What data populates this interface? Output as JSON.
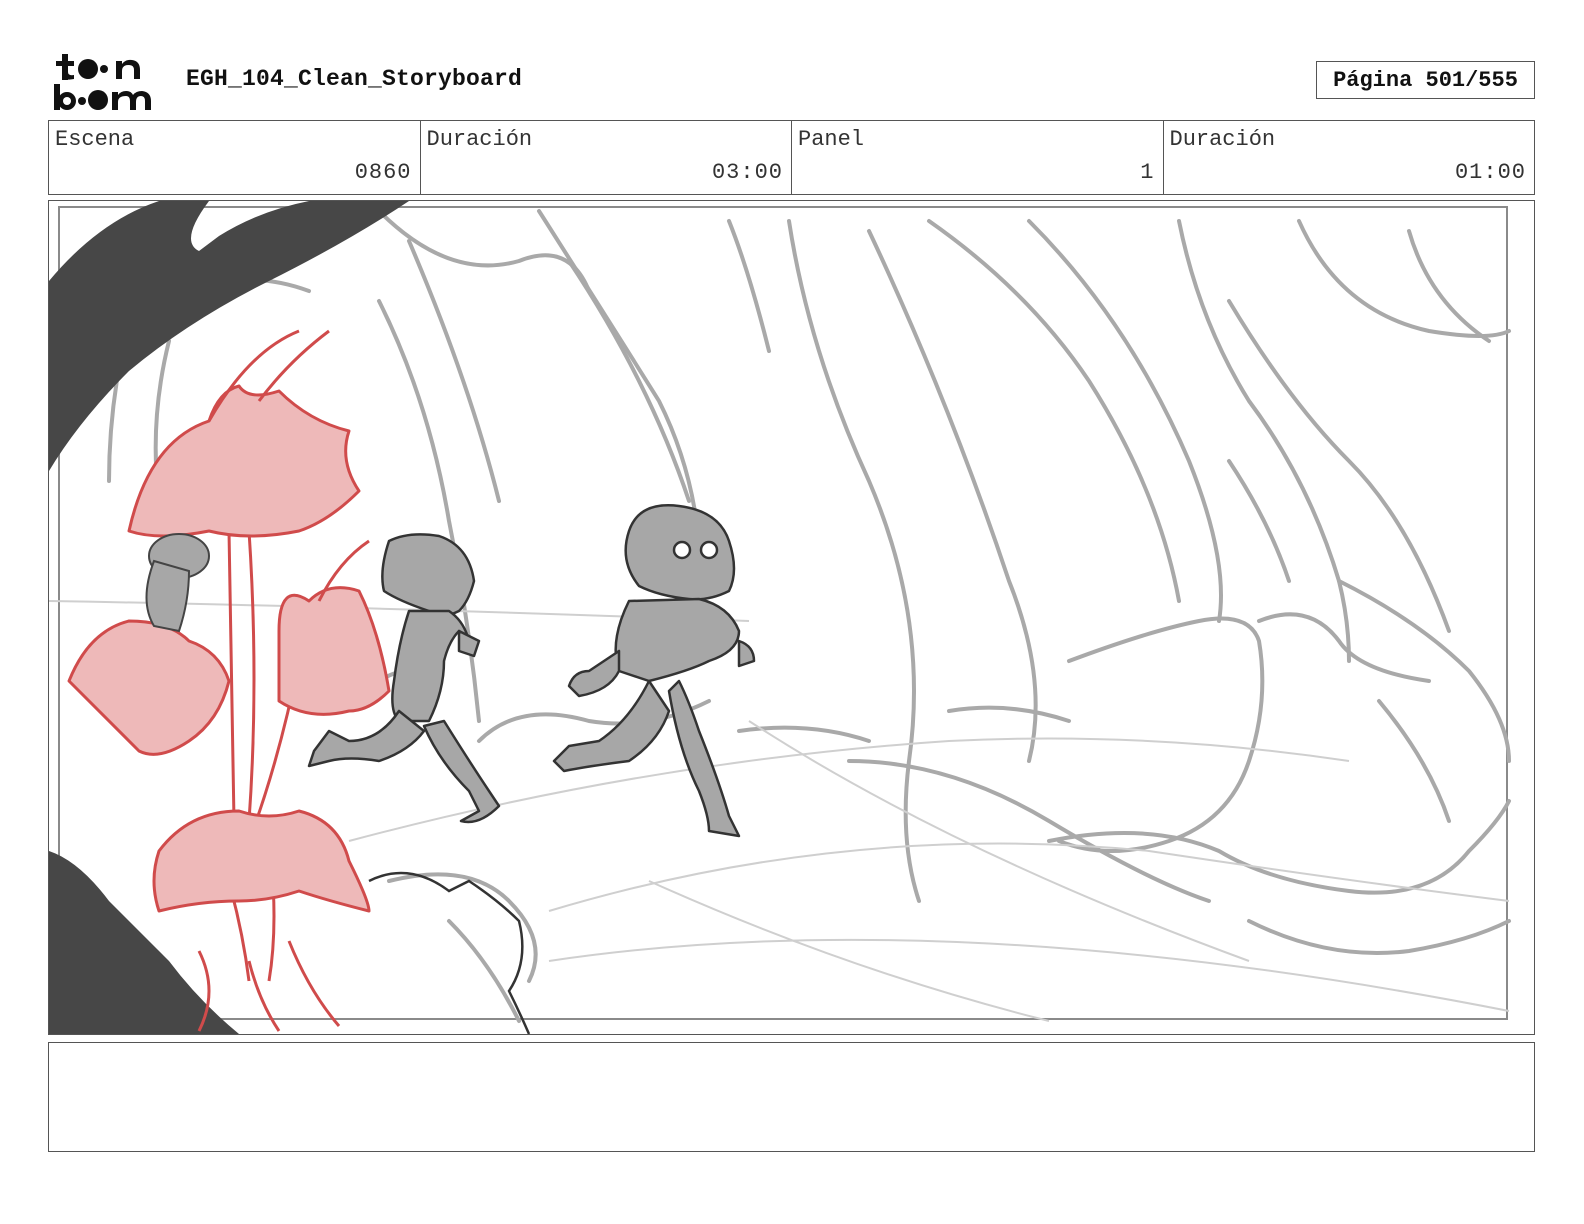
{
  "header": {
    "logo_text": "toon boom",
    "title": "EGH_104_Clean_Storyboard",
    "page_label": "Página 501/555"
  },
  "info": {
    "scene_label": "Escena",
    "scene_value": "0860",
    "scene_duration_label": "Duración",
    "scene_duration_value": "03:00",
    "panel_label": "Panel",
    "panel_value": "1",
    "panel_duration_label": "Duración",
    "panel_duration_value": "01:00"
  },
  "notes": {
    "text": ""
  },
  "colors": {
    "border": "#555555",
    "sketch_gray": "#aaaaaa",
    "flower_red": "#d04b4b",
    "flower_fill": "#eeb9b9",
    "dark_tree": "#474747",
    "character_fill": "#a7a7a7"
  }
}
